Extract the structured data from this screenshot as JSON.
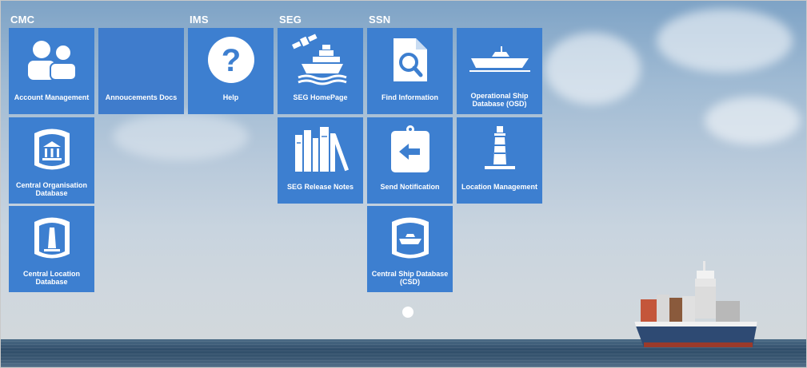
{
  "groups": {
    "cmc": "CMC",
    "ims": "IMS",
    "seg": "SEG",
    "ssn": "SSN"
  },
  "tiles": {
    "account_management": {
      "label": "Account Management",
      "icon": "users-icon"
    },
    "announcements_docs": {
      "label": "Annoucements Docs",
      "icon": ""
    },
    "help": {
      "label": "Help",
      "icon": "help-icon"
    },
    "seg_homepage": {
      "label": "SEG HomePage",
      "icon": "satellite-ship-icon"
    },
    "find_information": {
      "label": "Find Information",
      "icon": "document-search-icon"
    },
    "osd": {
      "label": "Operational Ship Database (OSD)",
      "icon": "boat-icon"
    },
    "central_org_db": {
      "label": "Central Organisation Database",
      "icon": "organisation-database-icon"
    },
    "seg_release_notes": {
      "label": "SEG Release Notes",
      "icon": "books-icon"
    },
    "send_notification": {
      "label": "Send Notification",
      "icon": "clipboard-arrow-icon"
    },
    "location_management": {
      "label": "Location Management",
      "icon": "lighthouse-icon"
    },
    "central_location_db": {
      "label": "Central Location Database",
      "icon": "location-database-icon"
    },
    "csd": {
      "label": "Central Ship Database (CSD)",
      "icon": "ship-database-icon"
    }
  },
  "colors": {
    "tile": "#3d7fd0",
    "label": "#ffffff"
  }
}
